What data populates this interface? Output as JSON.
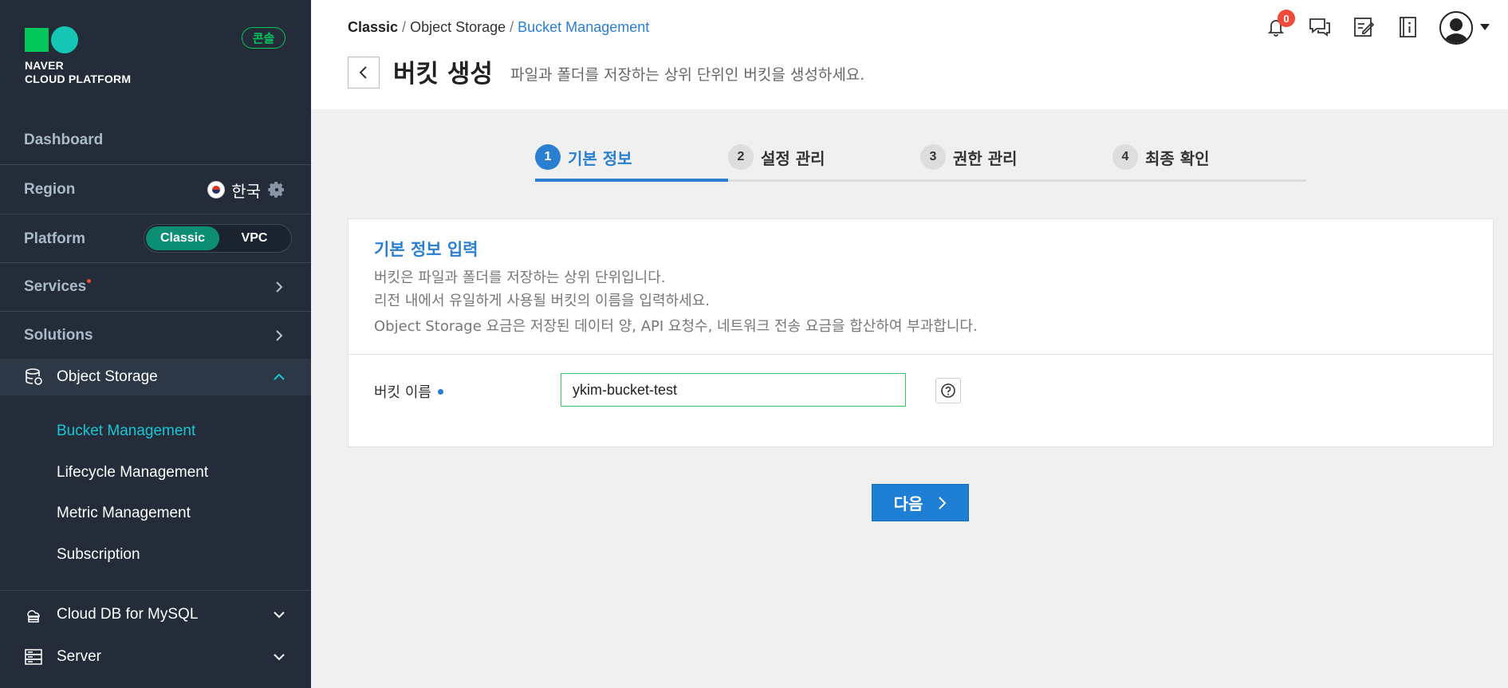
{
  "sidebar": {
    "logo_line1": "NAVER",
    "logo_line2": "CLOUD PLATFORM",
    "console_badge": "콘솔",
    "dashboard": "Dashboard",
    "region_label": "Region",
    "region_value": "한국",
    "platform_label": "Platform",
    "platform_options": [
      "Classic",
      "VPC"
    ],
    "platform_selected": "Classic",
    "services": "Services",
    "solutions": "Solutions",
    "object_storage": {
      "title": "Object Storage",
      "items": [
        {
          "label": "Bucket Management",
          "active": true
        },
        {
          "label": "Lifecycle Management",
          "active": false
        },
        {
          "label": "Metric Management",
          "active": false
        },
        {
          "label": "Subscription",
          "active": false
        }
      ]
    },
    "groups": [
      {
        "label": "Cloud DB for MySQL",
        "icon": "cloud-db-icon"
      },
      {
        "label": "Server",
        "icon": "server-icon"
      }
    ]
  },
  "header": {
    "breadcrumbs": [
      "Classic",
      "Object Storage",
      "Bucket Management"
    ],
    "separator": "/",
    "title": "버킷 생성",
    "description": "파일과 폴더를 저장하는 상위 단위인 버킷을 생성하세요.",
    "notification_count": "0"
  },
  "steps": [
    {
      "num": "1",
      "label": "기본 정보",
      "active": true
    },
    {
      "num": "2",
      "label": "설정 관리",
      "active": false
    },
    {
      "num": "3",
      "label": "권한 관리",
      "active": false
    },
    {
      "num": "4",
      "label": "최종 확인",
      "active": false
    }
  ],
  "form": {
    "title": "기본 정보 입력",
    "lines": [
      "버킷은 파일과 폴더를 저장하는 상위 단위입니다.",
      "리전 내에서 유일하게 사용될 버킷의 이름을 입력하세요.",
      "Object Storage 요금은 저장된 데이터 양, API 요청수, 네트워크 전송 요금을 합산하여 부과합니다."
    ],
    "bucket_name_label": "버킷 이름",
    "bucket_name_value": "ykim-bucket-test",
    "next_label": "다음"
  },
  "colors": {
    "sidebar_bg": "#232c38",
    "accent_blue": "#2a7fd1",
    "accent_green": "#03c75a",
    "active_teal": "#16c6d4"
  }
}
